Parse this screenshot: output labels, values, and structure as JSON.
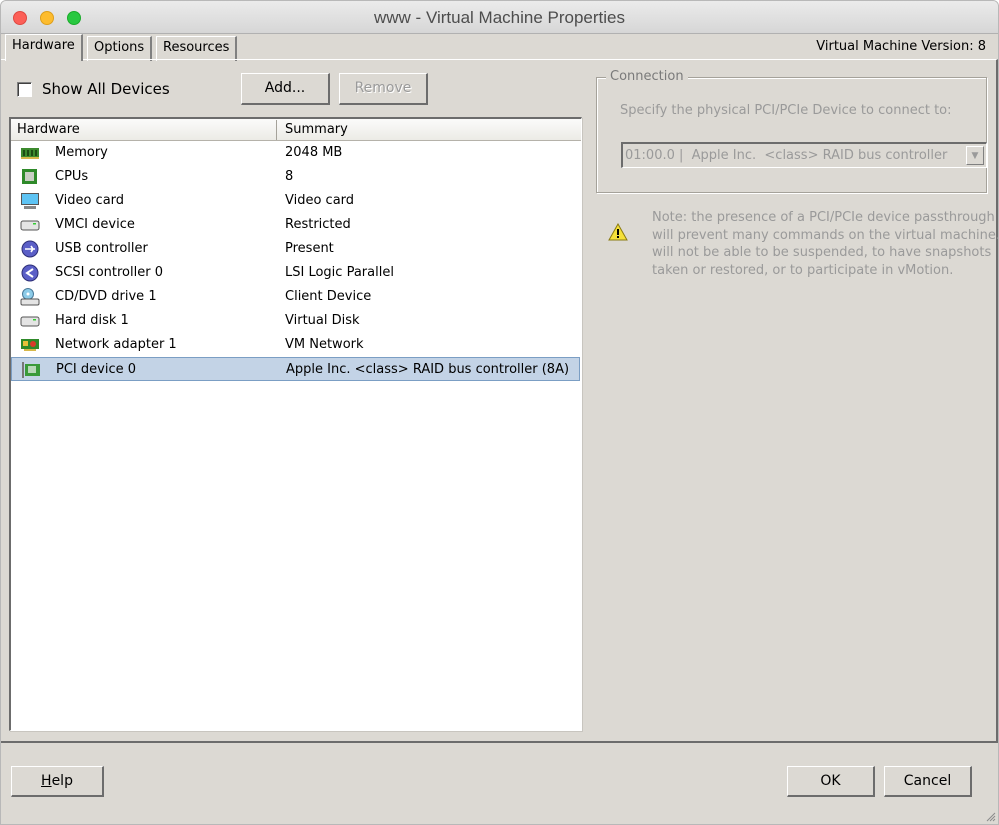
{
  "window": {
    "title": "www - Virtual Machine Properties",
    "version_label": "Virtual Machine Version: 8"
  },
  "tabs": [
    {
      "label": "Hardware",
      "active": true
    },
    {
      "label": "Options",
      "active": false
    },
    {
      "label": "Resources",
      "active": false
    }
  ],
  "hardware": {
    "show_all_devices": {
      "label": "Show All Devices",
      "checked": false
    },
    "add_label": "Add...",
    "remove_label": "Remove",
    "columns": [
      "Hardware",
      "Summary"
    ],
    "rows": [
      {
        "icon": "memory-icon",
        "name": "Memory",
        "summary": "2048 MB"
      },
      {
        "icon": "cpu-icon",
        "name": "CPUs",
        "summary": "8"
      },
      {
        "icon": "monitor-icon",
        "name": "Video card",
        "summary": "Video card"
      },
      {
        "icon": "device-drive-icon",
        "name": "VMCI device",
        "summary": "Restricted"
      },
      {
        "icon": "usb-icon",
        "name": "USB controller",
        "summary": "Present"
      },
      {
        "icon": "scsi-icon",
        "name": "SCSI controller 0",
        "summary": "LSI Logic Parallel"
      },
      {
        "icon": "cd-dvd-icon",
        "name": "CD/DVD drive 1",
        "summary": "Client Device"
      },
      {
        "icon": "hard-disk-icon",
        "name": "Hard disk 1",
        "summary": "Virtual Disk"
      },
      {
        "icon": "network-adapter-icon",
        "name": "Network adapter 1",
        "summary": "VM Network"
      },
      {
        "icon": "pci-card-icon",
        "name": "PCI device 0",
        "summary": "Apple Inc. <class> RAID bus controller (8A)",
        "selected": true
      }
    ]
  },
  "connection": {
    "legend": "Connection",
    "description": "Specify the physical PCI/PCIe Device to connect to:",
    "device_select_value": "01:00.0 |  Apple Inc.  <class> RAID bus controller",
    "note_lines": [
      "Note: the presence of a PCI/PCIe device passthrough",
      "will prevent many commands on the virtual machine. It",
      "will not be able to be suspended, to have snapshots",
      "taken or restored, or to participate in vMotion."
    ]
  },
  "footer": {
    "help_label_accel": "H",
    "help_label_rest": "elp",
    "ok_label": "OK",
    "cancel_label": "Cancel"
  },
  "colors": {
    "selection_bg": "#c3d3e6",
    "window_bg": "#dcd9d3",
    "disabled_text": "#9a9a9a"
  }
}
